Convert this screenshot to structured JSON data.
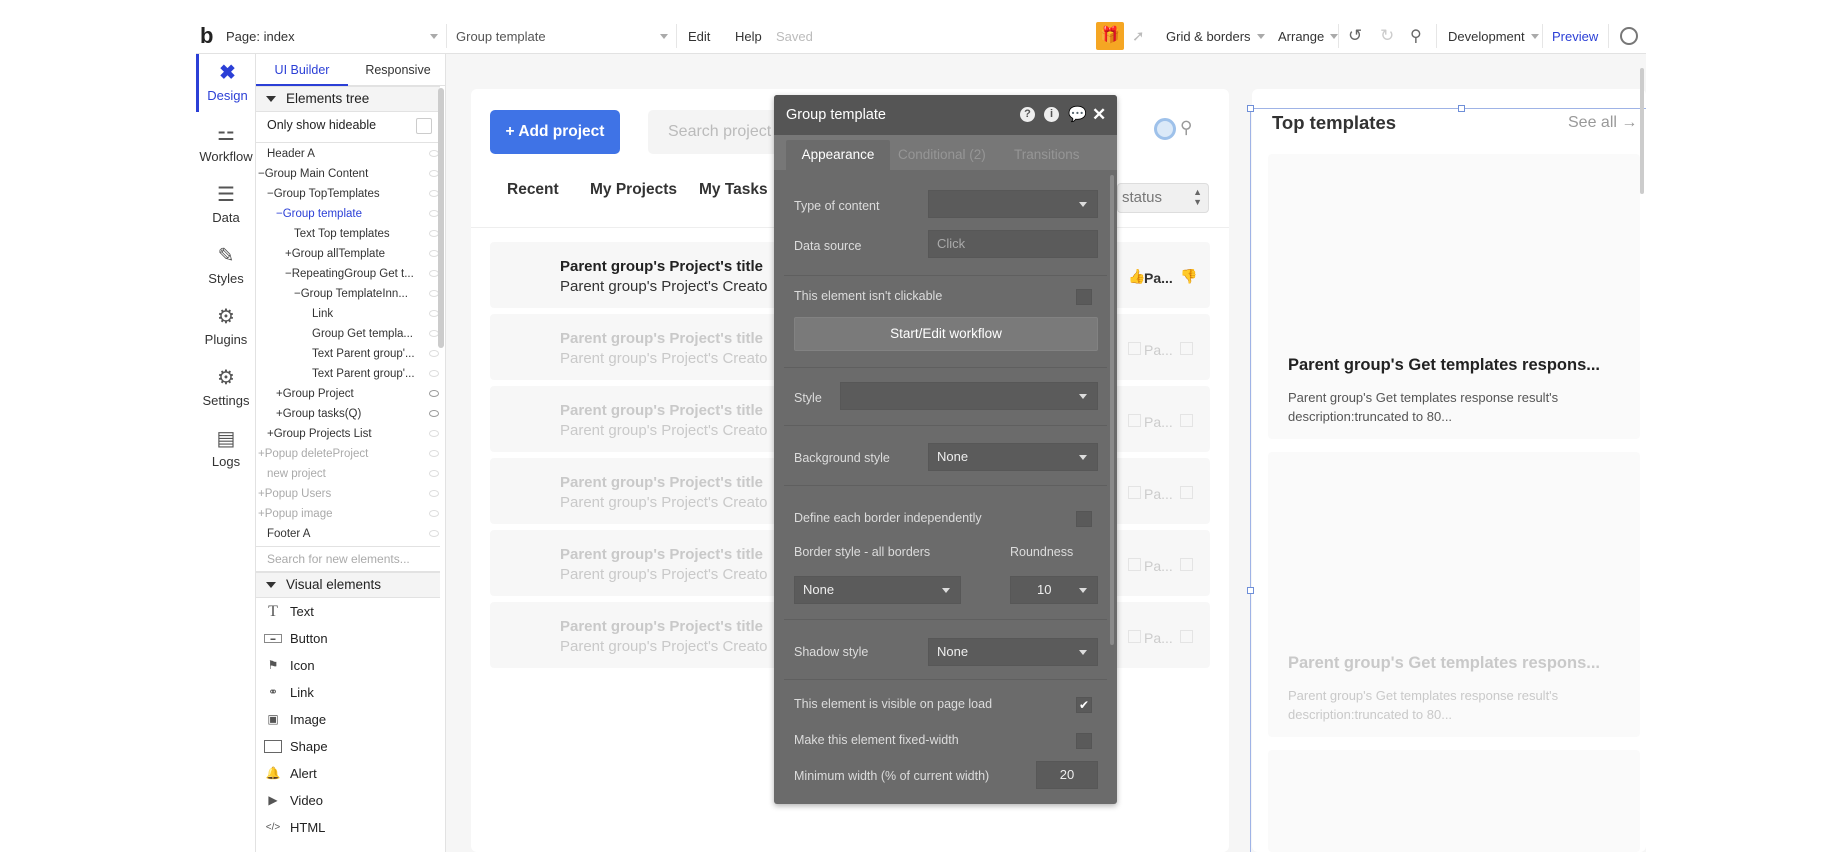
{
  "topbar": {
    "logo": "b",
    "page_label": "Page: index",
    "element_select": "Group template",
    "menu_edit": "Edit",
    "menu_help": "Help",
    "status": "Saved",
    "grid_borders": "Grid & borders",
    "arrange": "Arrange",
    "environment": "Development",
    "preview": "Preview"
  },
  "leftnav": {
    "items": [
      {
        "label": "Design",
        "icon": "design-icon"
      },
      {
        "label": "Workflow",
        "icon": "workflow-icon"
      },
      {
        "label": "Data",
        "icon": "database-icon"
      },
      {
        "label": "Styles",
        "icon": "brush-icon"
      },
      {
        "label": "Plugins",
        "icon": "plugin-icon"
      },
      {
        "label": "Settings",
        "icon": "gear-icon"
      },
      {
        "label": "Logs",
        "icon": "document-icon"
      }
    ]
  },
  "panel": {
    "tab_ui_builder": "UI Builder",
    "tab_responsive": "Responsive",
    "elements_tree_title": "Elements tree",
    "only_show_hideable": "Only show hideable",
    "tree": [
      "Header A",
      "Group Main Content",
      "Group TopTemplates",
      "Group template",
      "Text Top templates",
      "Group allTemplate",
      "RepeatingGroup Get t...",
      "Group TemplateInn...",
      "Link",
      "Group Get templa...",
      "Text Parent group'...",
      "Text Parent group'...",
      "Group Project",
      "Group tasks(Q)",
      "Group Projects List",
      "Popup deleteProject",
      "new project",
      "Popup Users",
      "Popup image",
      "Footer A"
    ],
    "search_placeholder": "Search for new elements...",
    "visual_elements_title": "Visual elements",
    "visual_elements": [
      "Text",
      "Button",
      "Icon",
      "Link",
      "Image",
      "Shape",
      "Alert",
      "Video",
      "HTML"
    ]
  },
  "canvas": {
    "add_project_button": "+ Add project",
    "search_placeholder": "Search project",
    "tabs": [
      "Recent",
      "My Projects",
      "My Tasks"
    ],
    "status_select": "status",
    "project_rows": [
      {
        "title": "Parent group's Project's title",
        "creator": "Parent group's Project's Creato",
        "status": "Pa..."
      },
      {
        "title": "Parent group's Project's title",
        "creator": "Parent group's Project's Creato",
        "status": "Pa..."
      },
      {
        "title": "Parent group's Project's title",
        "creator": "Parent group's Project's Creato",
        "status": "Pa..."
      },
      {
        "title": "Parent group's Project's title",
        "creator": "Parent group's Project's Creato",
        "status": "Pa..."
      },
      {
        "title": "Parent group's Project's title",
        "creator": "Parent group's Project's Creato",
        "status": "Pa..."
      },
      {
        "title": "Parent group's Project's title",
        "creator": "Parent group's Project's Creato",
        "status": "Pa..."
      }
    ],
    "top_templates_title": "Top templates",
    "see_all": "See all",
    "template_cards": [
      {
        "title": "Parent group's Get templates respons...",
        "desc": "Parent group's Get templates response result's description:truncated to 80..."
      },
      {
        "title": "Parent group's Get templates respons...",
        "desc": "Parent group's Get templates response result's description:truncated to 80..."
      }
    ]
  },
  "dialog": {
    "title": "Group template",
    "tab_appearance": "Appearance",
    "tab_conditional": "Conditional (2)",
    "tab_transitions": "Transitions",
    "type_of_content": "Type of content",
    "data_source": "Data source",
    "data_source_value": "Click",
    "not_clickable": "This element isn't clickable",
    "workflow_button": "Start/Edit workflow",
    "style": "Style",
    "background_style": "Background style",
    "background_value": "None",
    "define_borders": "Define each border independently",
    "border_style": "Border style - all borders",
    "border_value": "None",
    "roundness": "Roundness",
    "roundness_value": "10",
    "shadow_style": "Shadow style",
    "shadow_value": "None",
    "visible_on_load": "This element is visible on page load",
    "fixed_width": "Make this element fixed-width",
    "min_width": "Minimum width (% of current width)",
    "min_width_value": "20"
  },
  "colors": {
    "accent": "#2b3fd6",
    "add_button": "#3f73e6",
    "dialog_bg": "#6b6b6b",
    "dialog_header": "#555555",
    "gift_badge": "#f5a623"
  }
}
